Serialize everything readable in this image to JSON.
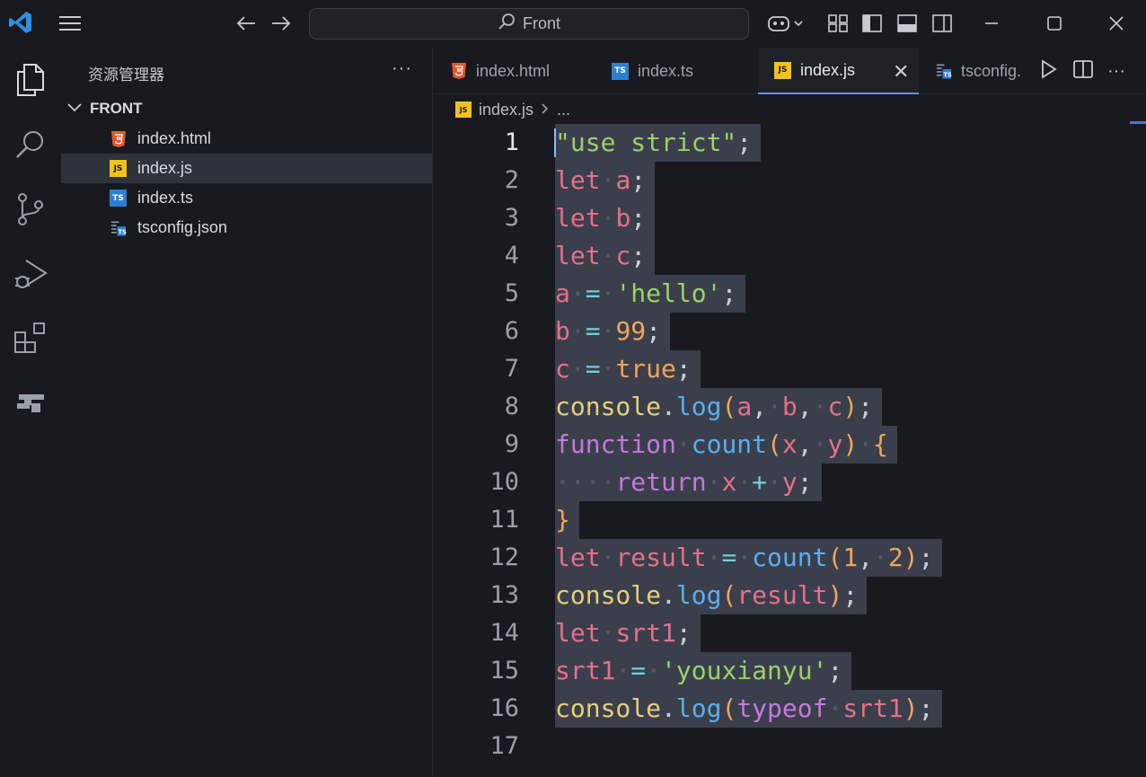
{
  "titlebar": {
    "search_text": "Front",
    "icons": [
      "vscode-logo-icon",
      "menu-icon",
      "back-arrow-icon",
      "forward-arrow-icon",
      "search-icon",
      "copilot-icon",
      "layout-customize-icon",
      "toggle-primary-sidebar-icon",
      "toggle-panel-icon",
      "toggle-secondary-sidebar-icon",
      "minimize-icon",
      "maximize-icon",
      "close-icon"
    ],
    "colors": {
      "accent": "#2f8fe0"
    }
  },
  "activity_bar": {
    "items": [
      "explorer-icon",
      "search-icon",
      "source-control-icon",
      "run-debug-icon",
      "extensions-icon",
      "remote-icon"
    ]
  },
  "sidebar": {
    "title": "资源管理器",
    "more": "···",
    "folder": "FRONT",
    "files": [
      {
        "name": "index.html",
        "icon": "html5-icon"
      },
      {
        "name": "index.js",
        "icon": "js-icon"
      },
      {
        "name": "index.ts",
        "icon": "ts-icon"
      },
      {
        "name": "tsconfig.json",
        "icon": "tsconfig-icon"
      }
    ],
    "active_file": "index.js"
  },
  "tabs": [
    {
      "label": "index.html",
      "icon": "html5-icon"
    },
    {
      "label": "index.ts",
      "icon": "ts-icon"
    },
    {
      "label": "index.js",
      "icon": "js-icon",
      "active": true
    },
    {
      "label": "tsconfig.",
      "icon": "tsconfig-icon"
    }
  ],
  "tab_close": "✕",
  "breadcrumb": {
    "file": "index.js",
    "rest": "..."
  },
  "code": {
    "line_numbers": [
      "1",
      "2",
      "3",
      "4",
      "5",
      "6",
      "7",
      "8",
      "9",
      "10",
      "11",
      "12",
      "13",
      "14",
      "15",
      "16",
      "17"
    ],
    "current_line": 1,
    "lines": [
      [
        [
          "str",
          "\"use strict\""
        ],
        [
          "pun",
          ";"
        ]
      ],
      [
        [
          "kw",
          "let"
        ],
        [
          "dot",
          "·"
        ],
        [
          "var",
          "a"
        ],
        [
          "pun",
          ";"
        ]
      ],
      [
        [
          "kw",
          "let"
        ],
        [
          "dot",
          "·"
        ],
        [
          "var",
          "b"
        ],
        [
          "pun",
          ";"
        ]
      ],
      [
        [
          "kw",
          "let"
        ],
        [
          "dot",
          "·"
        ],
        [
          "var",
          "c"
        ],
        [
          "pun",
          ";"
        ]
      ],
      [
        [
          "var",
          "a"
        ],
        [
          "dot",
          "·"
        ],
        [
          "op",
          "="
        ],
        [
          "dot",
          "·"
        ],
        [
          "str",
          "'hello'"
        ],
        [
          "pun",
          ";"
        ]
      ],
      [
        [
          "var",
          "b"
        ],
        [
          "dot",
          "·"
        ],
        [
          "op",
          "="
        ],
        [
          "dot",
          "·"
        ],
        [
          "num",
          "99"
        ],
        [
          "pun",
          ";"
        ]
      ],
      [
        [
          "var",
          "c"
        ],
        [
          "dot",
          "·"
        ],
        [
          "op",
          "="
        ],
        [
          "dot",
          "·"
        ],
        [
          "num",
          "true"
        ],
        [
          "pun",
          ";"
        ]
      ],
      [
        [
          "obj",
          "console"
        ],
        [
          "pun",
          "."
        ],
        [
          "fn",
          "log"
        ],
        [
          "par",
          "("
        ],
        [
          "var",
          "a"
        ],
        [
          "pun",
          ","
        ],
        [
          "dot",
          "·"
        ],
        [
          "var",
          "b"
        ],
        [
          "pun",
          ","
        ],
        [
          "dot",
          "·"
        ],
        [
          "var",
          "c"
        ],
        [
          "par",
          ")"
        ],
        [
          "pun",
          ";"
        ]
      ],
      [
        [
          "pur",
          "function"
        ],
        [
          "dot",
          "·"
        ],
        [
          "fn",
          "count"
        ],
        [
          "par",
          "("
        ],
        [
          "var",
          "x"
        ],
        [
          "pun",
          ","
        ],
        [
          "dot",
          "·"
        ],
        [
          "var",
          "y"
        ],
        [
          "par",
          ")"
        ],
        [
          "dot",
          "·"
        ],
        [
          "par",
          "{"
        ]
      ],
      [
        [
          "dot",
          "····"
        ],
        [
          "pur",
          "return"
        ],
        [
          "dot",
          "·"
        ],
        [
          "var",
          "x"
        ],
        [
          "dot",
          "·"
        ],
        [
          "op",
          "+"
        ],
        [
          "dot",
          "·"
        ],
        [
          "var",
          "y"
        ],
        [
          "pun",
          ";"
        ]
      ],
      [
        [
          "par",
          "}"
        ]
      ],
      [
        [
          "kw",
          "let"
        ],
        [
          "dot",
          "·"
        ],
        [
          "var",
          "result"
        ],
        [
          "dot",
          "·"
        ],
        [
          "op",
          "="
        ],
        [
          "dot",
          "·"
        ],
        [
          "fn",
          "count"
        ],
        [
          "par",
          "("
        ],
        [
          "num",
          "1"
        ],
        [
          "pun",
          ","
        ],
        [
          "dot",
          "·"
        ],
        [
          "num",
          "2"
        ],
        [
          "par",
          ")"
        ],
        [
          "pun",
          ";"
        ]
      ],
      [
        [
          "obj",
          "console"
        ],
        [
          "pun",
          "."
        ],
        [
          "fn",
          "log"
        ],
        [
          "par",
          "("
        ],
        [
          "var",
          "result"
        ],
        [
          "par",
          ")"
        ],
        [
          "pun",
          ";"
        ]
      ],
      [
        [
          "kw",
          "let"
        ],
        [
          "dot",
          "·"
        ],
        [
          "var",
          "srt1"
        ],
        [
          "pun",
          ";"
        ]
      ],
      [
        [
          "var",
          "srt1"
        ],
        [
          "dot",
          "·"
        ],
        [
          "op",
          "="
        ],
        [
          "dot",
          "·"
        ],
        [
          "str",
          "'youxianyu'"
        ],
        [
          "pun",
          ";"
        ]
      ],
      [
        [
          "obj",
          "console"
        ],
        [
          "pun",
          "."
        ],
        [
          "fn",
          "log"
        ],
        [
          "par",
          "("
        ],
        [
          "pur",
          "typeof"
        ],
        [
          "dot",
          "·"
        ],
        [
          "var",
          "srt1"
        ],
        [
          "par",
          ")"
        ],
        [
          "pun",
          ";"
        ]
      ],
      []
    ]
  }
}
